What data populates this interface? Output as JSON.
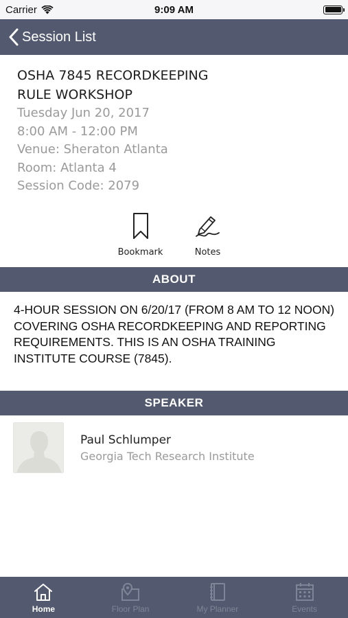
{
  "status": {
    "carrier": "Carrier",
    "time": "9:09 AM"
  },
  "nav": {
    "back_label": "Session List"
  },
  "session": {
    "title_line1": "OSHA 7845 RECORDKEEPING",
    "title_line2": "RULE WORKSHOP",
    "date": "Tuesday Jun 20, 2017",
    "time": "8:00 AM - 12:00 PM",
    "venue": "Venue: Sheraton Atlanta",
    "room": "Room: Atlanta 4",
    "code": "Session Code: 2079"
  },
  "actions": {
    "bookmark_label": "Bookmark",
    "notes_label": "Notes"
  },
  "about": {
    "header": "ABOUT",
    "text": "4-HOUR SESSION ON 6/20/17 (FROM 8 AM TO 12 NOON) COVERING OSHA RECORDKEEPING AND REPORTING REQUIREMENTS. THIS IS AN OSHA TRAINING INSTITUTE COURSE (7845)."
  },
  "speaker_section": {
    "header": "SPEAKER",
    "name": "Paul Schlumper",
    "organization": "Georgia Tech Research Institute"
  },
  "tabs": [
    {
      "label": "Home",
      "icon": "home-icon",
      "active": true
    },
    {
      "label": "Floor Plan",
      "icon": "floor-plan-icon",
      "active": false
    },
    {
      "label": "My Planner",
      "icon": "planner-icon",
      "active": false
    },
    {
      "label": "Events",
      "icon": "calendar-icon",
      "active": false
    }
  ],
  "colors": {
    "bar_background": "#535a6f",
    "secondary_text": "#9a9a9a",
    "inactive_tab": "#7e8598",
    "active_tab": "#ffffff"
  }
}
